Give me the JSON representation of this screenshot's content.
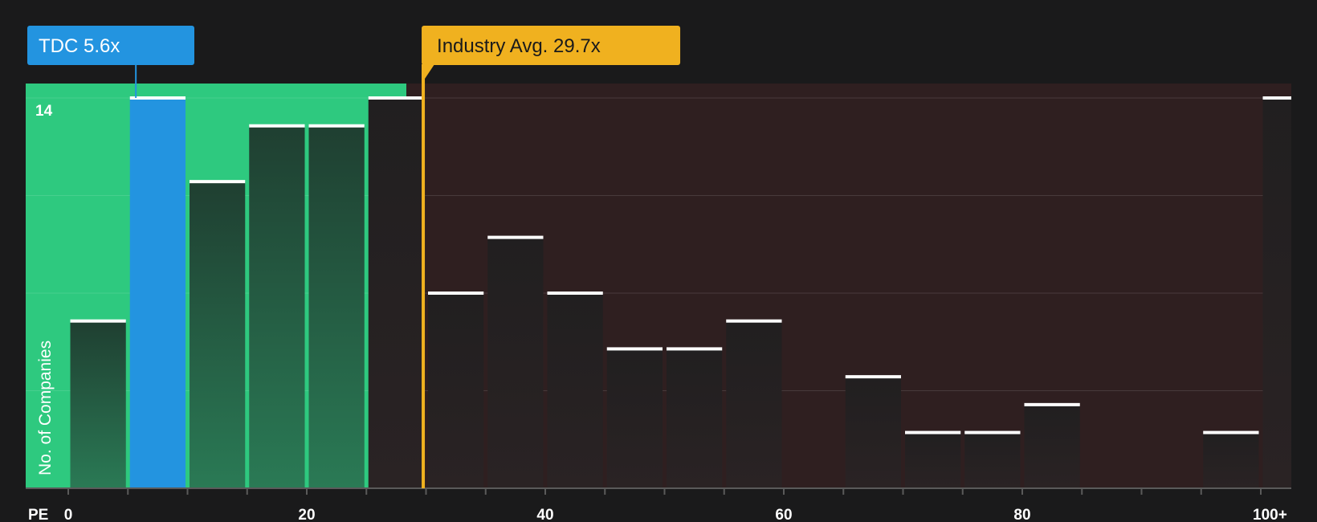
{
  "chart_data": {
    "type": "bar",
    "xlabel": "PE",
    "ylabel": "No. of Companies",
    "x_ticks": [
      "0",
      "20",
      "40",
      "60",
      "80",
      "100+"
    ],
    "y_tick_label": "14",
    "ylim": [
      0,
      14
    ],
    "bin_width": 5,
    "bins": [
      {
        "start": 0,
        "value": 6
      },
      {
        "start": 5,
        "value": 14
      },
      {
        "start": 10,
        "value": 11
      },
      {
        "start": 15,
        "value": 13
      },
      {
        "start": 20,
        "value": 13
      },
      {
        "start": 25,
        "value": 14
      },
      {
        "start": 30,
        "value": 7
      },
      {
        "start": 35,
        "value": 9
      },
      {
        "start": 40,
        "value": 7
      },
      {
        "start": 45,
        "value": 5
      },
      {
        "start": 50,
        "value": 5
      },
      {
        "start": 55,
        "value": 6
      },
      {
        "start": 60,
        "value": 0
      },
      {
        "start": 65,
        "value": 4
      },
      {
        "start": 70,
        "value": 2
      },
      {
        "start": 75,
        "value": 2
      },
      {
        "start": 80,
        "value": 3
      },
      {
        "start": 85,
        "value": 0
      },
      {
        "start": 90,
        "value": 0
      },
      {
        "start": 95,
        "value": 2
      },
      {
        "start": 100,
        "value": 14
      }
    ],
    "company": {
      "label": "TDC 5.6x",
      "value": 5.6,
      "color": "#2394e0"
    },
    "industry": {
      "label": "Industry Avg. 29.7x",
      "value": 29.7,
      "color": "#f0b11f"
    },
    "grid": true,
    "colors": {
      "below_region": "#2ec97f",
      "above_region": "#2f1f20",
      "below_bar": "#1f4a38",
      "above_bar": "#232021",
      "bar_cap": "#ffffff",
      "axis": "#5a5a5a",
      "text": "#ffffff"
    }
  }
}
